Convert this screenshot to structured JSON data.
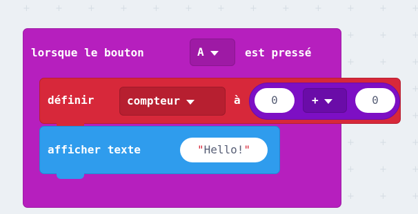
{
  "workspace": {
    "background": "#ecf0f4",
    "grid_glyph": "+"
  },
  "colors": {
    "event_block": "#b61fbe",
    "set_block": "#d7283a",
    "show_block": "#2f9ced",
    "math_block": "#7d0fc4",
    "text": "#ffffff",
    "field_text": "#575e75"
  },
  "event_block": {
    "prefix": "lorsque le bouton",
    "button_value": "A",
    "suffix": "est pressé"
  },
  "set_block": {
    "label": "définir",
    "variable": "compteur",
    "to_label": "à"
  },
  "math_block": {
    "left_value": "0",
    "operator": "+",
    "right_value": "0"
  },
  "show_block": {
    "label": "afficher texte",
    "text_value": "Hello!",
    "quote_char": "\""
  },
  "icons": {
    "dropdown_caret": "chevron-down-icon"
  }
}
